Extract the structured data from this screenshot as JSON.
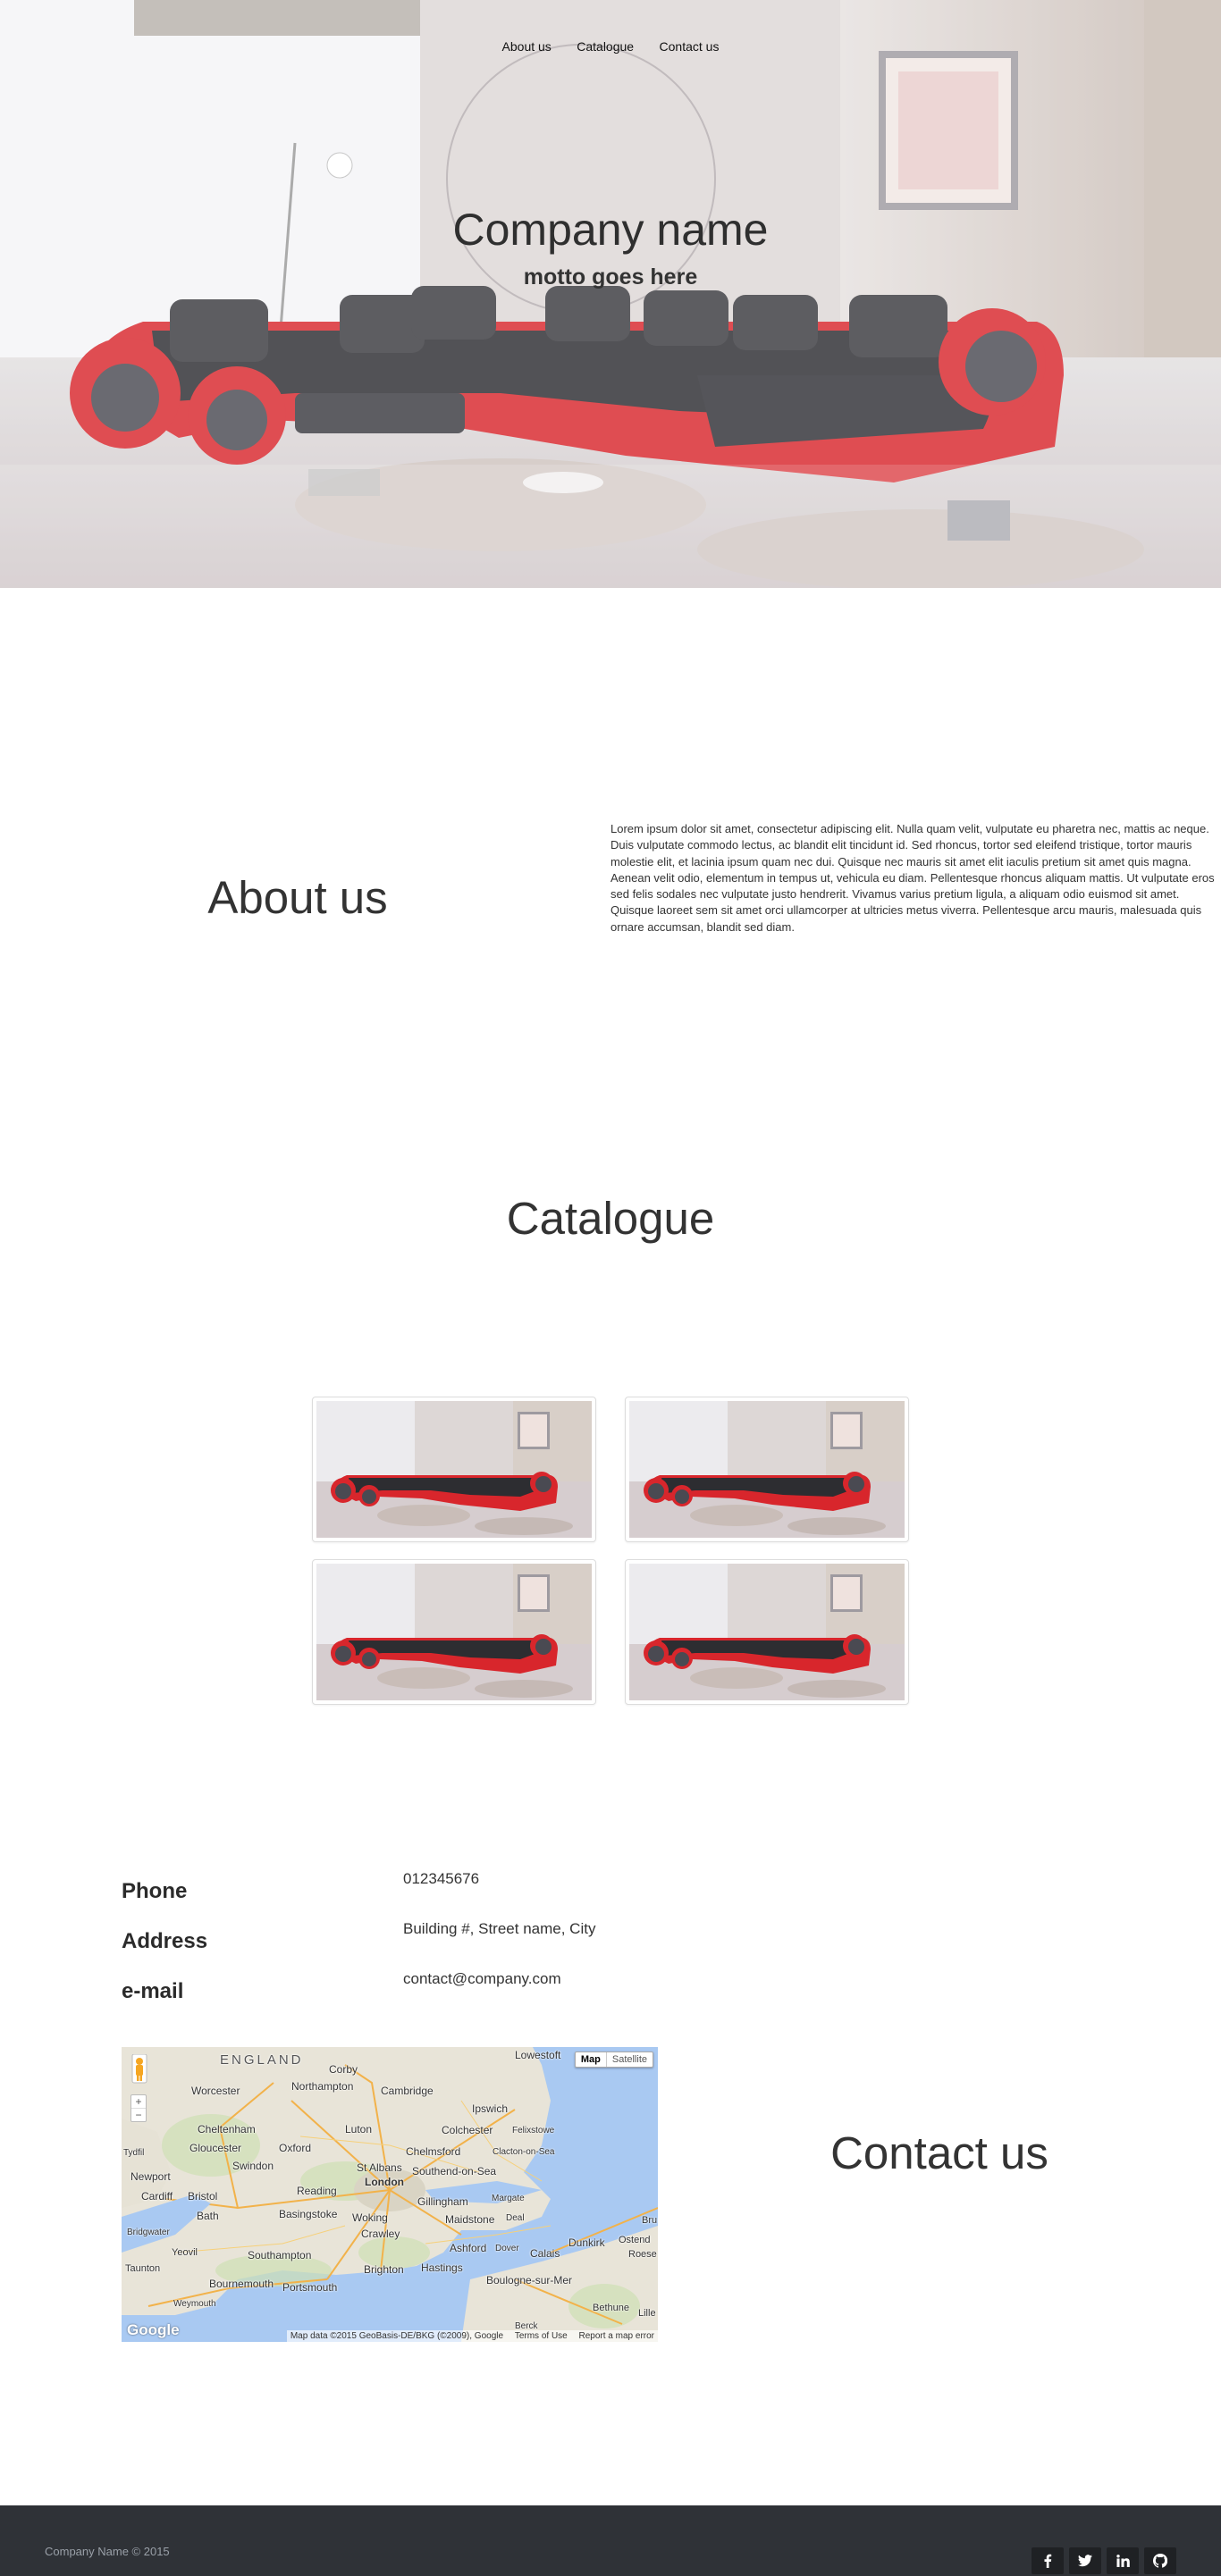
{
  "nav": {
    "items": [
      {
        "label": "About us"
      },
      {
        "label": "Catalogue"
      },
      {
        "label": "Contact us"
      }
    ]
  },
  "hero": {
    "title": "Company name",
    "motto": "motto goes here"
  },
  "about": {
    "heading": "About us",
    "text": "Lorem ipsum dolor sit amet, consectetur adipiscing elit. Nulla quam velit, vulputate eu pharetra nec, mattis ac neque. Duis vulputate commodo lectus, ac blandit elit tincidunt id. Sed rhoncus, tortor sed eleifend tristique, tortor mauris molestie elit, et lacinia ipsum quam nec dui. Quisque nec mauris sit amet elit iaculis pretium sit amet quis magna. Aenean velit odio, elementum in tempus ut, vehicula eu diam. Pellentesque rhoncus aliquam mattis. Ut vulputate eros sed felis sodales nec vulputate justo hendrerit. Vivamus varius pretium ligula, a aliquam odio euismod sit amet. Quisque laoreet sem sit amet orci ullamcorper at ultricies metus viverra. Pellentesque arcu mauris, malesuada quis ornare accumsan, blandit sed diam."
  },
  "catalogue": {
    "heading": "Catalogue",
    "items_count_shown": 4
  },
  "contact": {
    "heading": "Contact us",
    "rows": [
      {
        "label": "Phone",
        "value": "012345676"
      },
      {
        "label": "Address",
        "value": "Building #, Street name, City"
      },
      {
        "label": "e-mail",
        "value": "contact@company.com"
      }
    ],
    "map": {
      "type_buttons": [
        "Map",
        "Satellite"
      ],
      "zoom_in": "+",
      "zoom_out": "−",
      "logo": "Google",
      "credits": [
        "Map data ©2015 GeoBasis-DE/BKG (©2009), Google",
        "Terms of Use",
        "Report a map error"
      ],
      "region_label": "ENGLAND",
      "places": [
        "Worcester",
        "Corby",
        "Lowestoft",
        "Northampton",
        "Cambridge",
        "Ipswich",
        "Cheltenham",
        "Luton",
        "Colchester",
        "Felixstowe",
        "Gloucester",
        "Oxford",
        "Chelmsford",
        "Clacton-on-Sea",
        "Tydfil",
        "Swindon",
        "St Albans",
        "Southend-on-Sea",
        "Newport",
        "Cardiff",
        "Bristol",
        "Reading",
        "London",
        "Margate",
        "Bath",
        "Basingstoke",
        "Woking",
        "Gillingham",
        "Maidstone",
        "Deal",
        "Bridgwater",
        "Crawley",
        "Dunkirk",
        "Ostend",
        "Yeovil",
        "Southampton",
        "Ashford",
        "Dover",
        "Calais",
        "Roese",
        "Taunton",
        "Brighton",
        "Hastings",
        "Bournemouth",
        "Portsmouth",
        "Boulogne-sur-Mer",
        "Weymouth",
        "Berck",
        "Bethune",
        "Lille",
        "Bru"
      ]
    }
  },
  "footer": {
    "copyright": "Company Name © 2015",
    "social": [
      {
        "icon": "facebook-icon",
        "glyph": "f"
      },
      {
        "icon": "twitter-icon",
        "glyph": "t"
      },
      {
        "icon": "linkedin-icon",
        "glyph": "in"
      },
      {
        "icon": "github-icon",
        "glyph": "gh"
      }
    ]
  },
  "colors": {
    "sofa_red": "#d8262c",
    "sofa_black": "#2d2d31",
    "footer_bg": "#2f3237",
    "map_water": "#a9c9f2",
    "map_land": "#e8e4d8"
  }
}
